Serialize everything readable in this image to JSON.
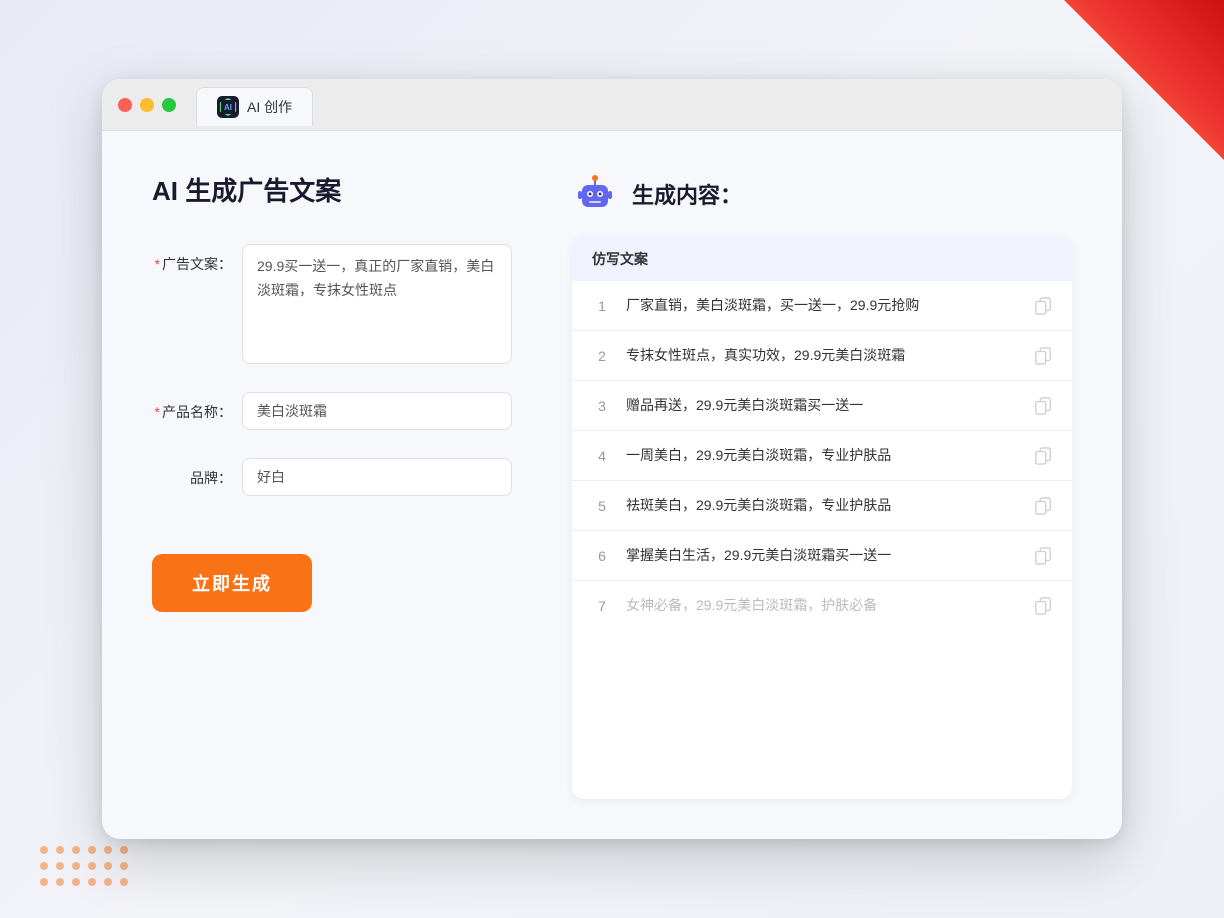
{
  "decoration": {
    "corner": true,
    "dots": true
  },
  "browser": {
    "tab": {
      "icon_label": "AI",
      "title": "AI 创作"
    }
  },
  "left_panel": {
    "page_title": "AI 生成广告文案",
    "form": {
      "ad_copy_label": "广告文案：",
      "ad_copy_required": "*",
      "ad_copy_value": "29.9买一送一，真正的厂家直销，美白淡斑霜，专抹女性斑点",
      "product_name_label": "产品名称：",
      "product_name_required": "*",
      "product_name_value": "美白淡斑霜",
      "brand_label": "品牌：",
      "brand_value": "好白"
    },
    "generate_btn": "立即生成"
  },
  "right_panel": {
    "header_title": "生成内容：",
    "table_header": "仿写文案",
    "rows": [
      {
        "num": "1",
        "text": "厂家直销，美白淡斑霜，买一送一，29.9元抢购",
        "muted": false
      },
      {
        "num": "2",
        "text": "专抹女性斑点，真实功效，29.9元美白淡斑霜",
        "muted": false
      },
      {
        "num": "3",
        "text": "赠品再送，29.9元美白淡斑霜买一送一",
        "muted": false
      },
      {
        "num": "4",
        "text": "一周美白，29.9元美白淡斑霜，专业护肤品",
        "muted": false
      },
      {
        "num": "5",
        "text": "祛斑美白，29.9元美白淡斑霜，专业护肤品",
        "muted": false
      },
      {
        "num": "6",
        "text": "掌握美白生活，29.9元美白淡斑霜买一送一",
        "muted": false
      },
      {
        "num": "7",
        "text": "女神必备，29.9元美白淡斑霜，护肤必备",
        "muted": true
      }
    ]
  }
}
